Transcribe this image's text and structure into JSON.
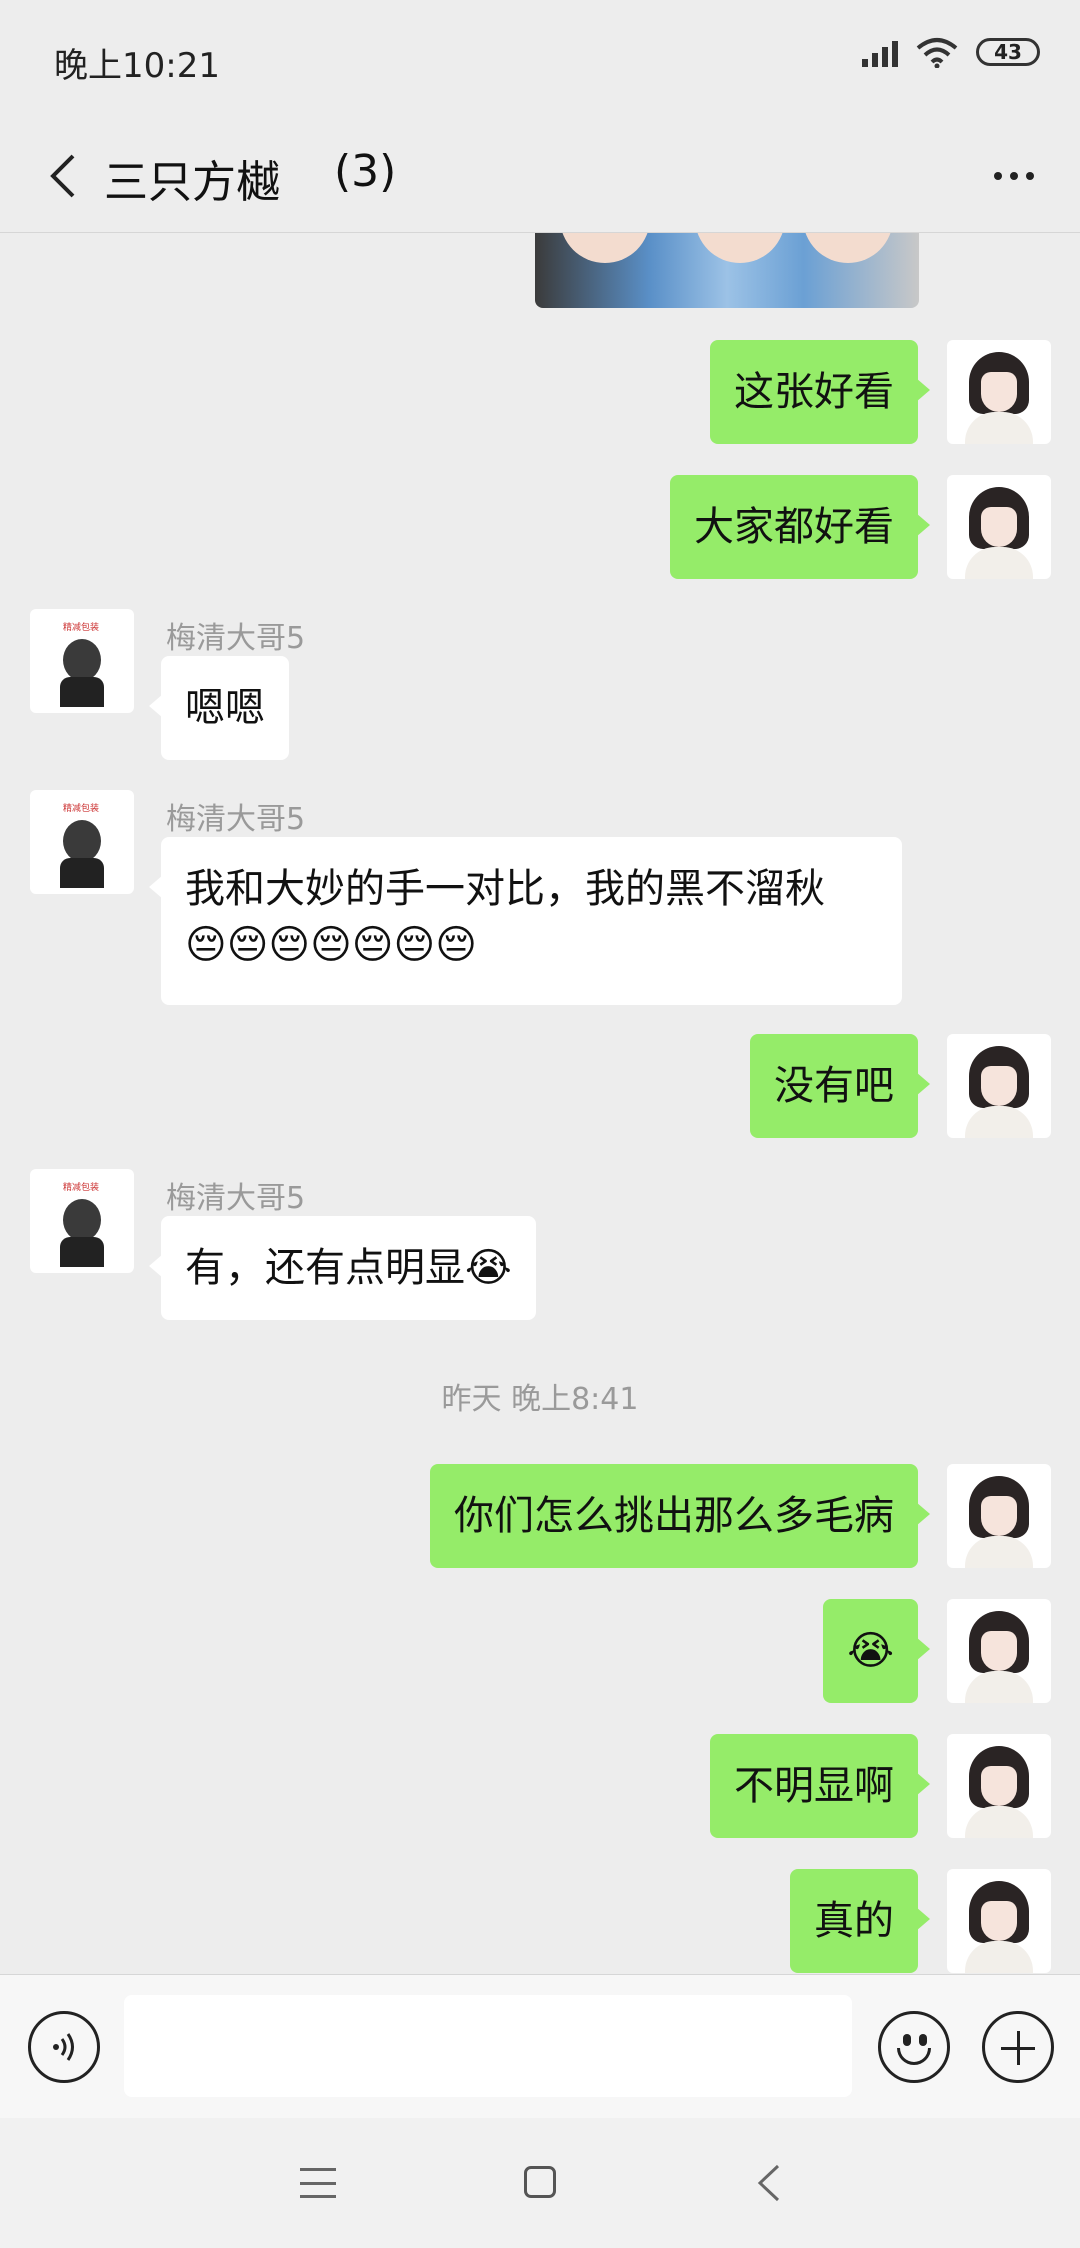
{
  "status_bar": {
    "time": "晚上10:21",
    "battery": "43",
    "icons": [
      "signal-icon",
      "wifi-icon",
      "battery-icon"
    ]
  },
  "header": {
    "title": "三只方樾",
    "member_count": "(3)",
    "back_icon": "chevron-left-icon",
    "more_icon": "more-dots-icon"
  },
  "messages": [
    {
      "type": "image",
      "from": "me",
      "alt": "group photo"
    },
    {
      "type": "text",
      "from": "me",
      "text": "这张好看"
    },
    {
      "type": "text",
      "from": "me",
      "text": "大家都好看"
    },
    {
      "type": "text",
      "from": "other",
      "sender": "梅清大哥5",
      "text": "嗯嗯"
    },
    {
      "type": "text",
      "from": "other",
      "sender": "梅清大哥5",
      "text": "我和大妙的手一对比，我的黑不溜秋",
      "emoji_line": "😔😔😔😔😔😔😔"
    },
    {
      "type": "text",
      "from": "me",
      "text": "没有吧"
    },
    {
      "type": "text",
      "from": "other",
      "sender": "梅清大哥5",
      "text": "有，还有点明显😭"
    },
    {
      "type": "timestamp",
      "text": "昨天 晚上8:41"
    },
    {
      "type": "text",
      "from": "me",
      "text": "你们怎么挑出那么多毛病"
    },
    {
      "type": "text",
      "from": "me",
      "text": "😭"
    },
    {
      "type": "text",
      "from": "me",
      "text": "不明显啊"
    },
    {
      "type": "text",
      "from": "me",
      "text": "真的"
    }
  ],
  "input_bar": {
    "value": "",
    "voice_icon": "voice-icon",
    "emoji_icon": "emoji-icon",
    "plus_icon": "plus-icon"
  },
  "nav_bar": {
    "icons": [
      "menu-icon",
      "home-icon",
      "back-icon"
    ]
  },
  "colors": {
    "background": "#ededed",
    "my_bubble": "#95ec69",
    "other_bubble": "#ffffff",
    "meta_text": "#9a9a9a"
  }
}
